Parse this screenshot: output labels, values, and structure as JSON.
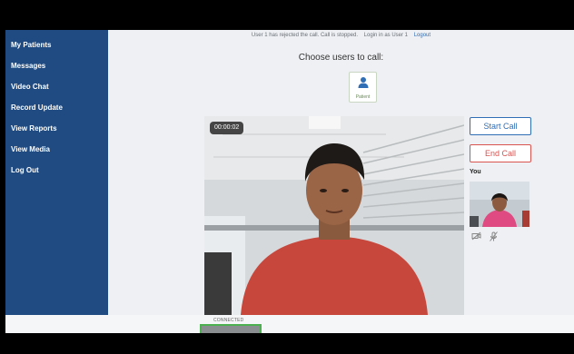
{
  "sidebar": {
    "items": [
      {
        "label": "My Patients"
      },
      {
        "label": "Messages"
      },
      {
        "label": "Video Chat"
      },
      {
        "label": "Record Update"
      },
      {
        "label": "View Reports"
      },
      {
        "label": "View Media"
      },
      {
        "label": "Log Out"
      }
    ]
  },
  "status": {
    "message": "User 1 has rejected the call. Call is stopped.",
    "login_info": "Login in as User 1",
    "logout_label": "Logout"
  },
  "call": {
    "title": "Choose users to call:",
    "patient_label": "Patient",
    "timer": "00:00:02",
    "start_label": "Start Call",
    "end_label": "End Call",
    "you_label": "You",
    "connected_label": "CONNECTED"
  },
  "colors": {
    "sidebar_bg": "#1f4b82",
    "accent_blue": "#2f6db5",
    "end_red": "#d9534f",
    "connected_green": "#4caf50"
  },
  "icons": {
    "patient": "person-icon",
    "camera_off": "camera-off-icon",
    "mic_off": "mic-off-icon"
  }
}
